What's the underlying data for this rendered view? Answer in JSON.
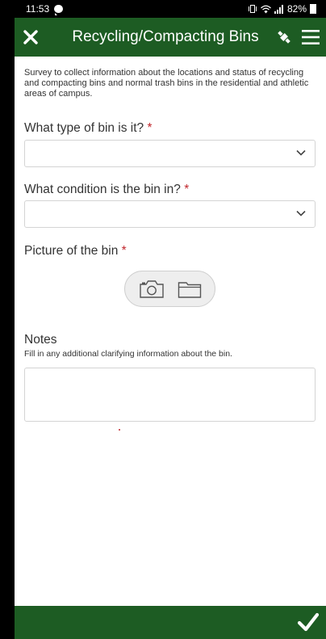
{
  "status_bar": {
    "time": "11:53",
    "battery_pct": "82%"
  },
  "app_bar": {
    "title": "Recycling/Compacting Bins"
  },
  "form": {
    "description": "Survey to collect information about the locations and status of recycling and compacting bins and normal trash bins in the residential and athletic areas of campus.",
    "required_marker": "*",
    "q1": {
      "label": "What type of bin is it?",
      "value": ""
    },
    "q2": {
      "label": "What condition is the bin in?",
      "value": ""
    },
    "q3": {
      "label": "Picture of the bin"
    },
    "notes": {
      "label": "Notes",
      "hint": "Fill in any additional clarifying information about the bin.",
      "value": ""
    }
  },
  "icons": [
    "close-icon",
    "gps-icon",
    "hamburger-menu-icon",
    "chevron-down-icon",
    "camera-icon",
    "folder-icon",
    "checkmark-icon"
  ],
  "colors": {
    "primary": "#1d5c23",
    "required": "#c1272d"
  }
}
